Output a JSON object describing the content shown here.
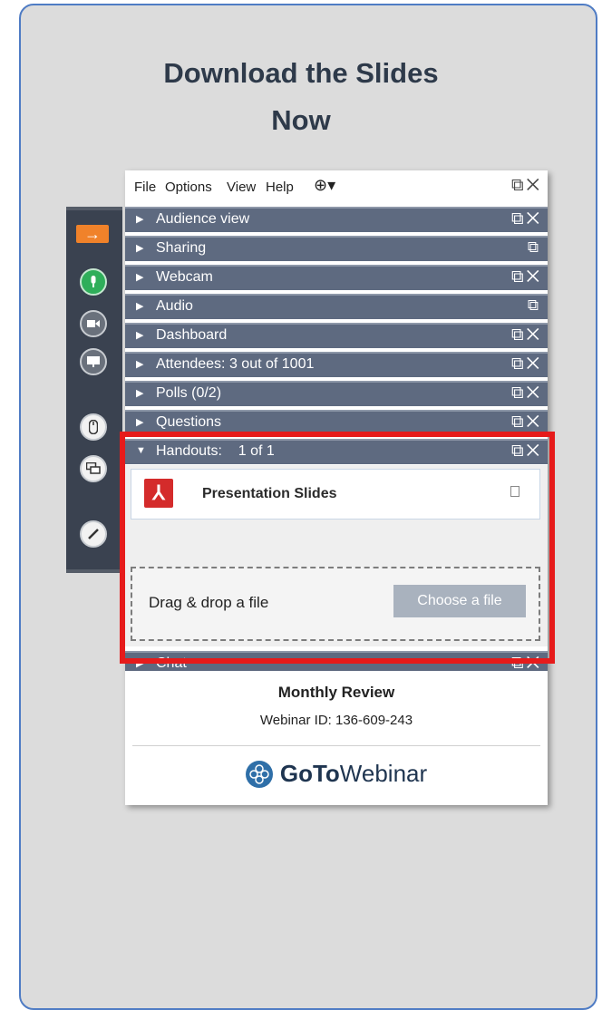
{
  "heading": {
    "line1": "Download the Slides",
    "line2": "Now"
  },
  "menu": {
    "file": "File",
    "options": "Options",
    "view": "View",
    "help": "Help"
  },
  "panels": [
    {
      "label": "Audience view"
    },
    {
      "label": "Sharing"
    },
    {
      "label": "Webcam"
    },
    {
      "label": "Audio"
    },
    {
      "label": "Dashboard"
    },
    {
      "label": "Attendees: 3 out of 1001"
    },
    {
      "label": "Polls (0/2)"
    },
    {
      "label": "Questions"
    },
    {
      "label": "Handouts:    1 of 1"
    },
    {
      "label": "Chat"
    }
  ],
  "handouts": {
    "file_name": "Presentation Slides",
    "drop_label": "Drag & drop a file",
    "choose_button": "Choose a file"
  },
  "footer": {
    "meeting_title": "Monthly Review",
    "webinar_id": "Webinar ID: 136-609-243",
    "brand_bold": "GoTo",
    "brand_rest": "Webinar"
  },
  "colors": {
    "highlight": "#e61b1b",
    "panel": "#5e6a80",
    "accent": "#f0822a"
  }
}
